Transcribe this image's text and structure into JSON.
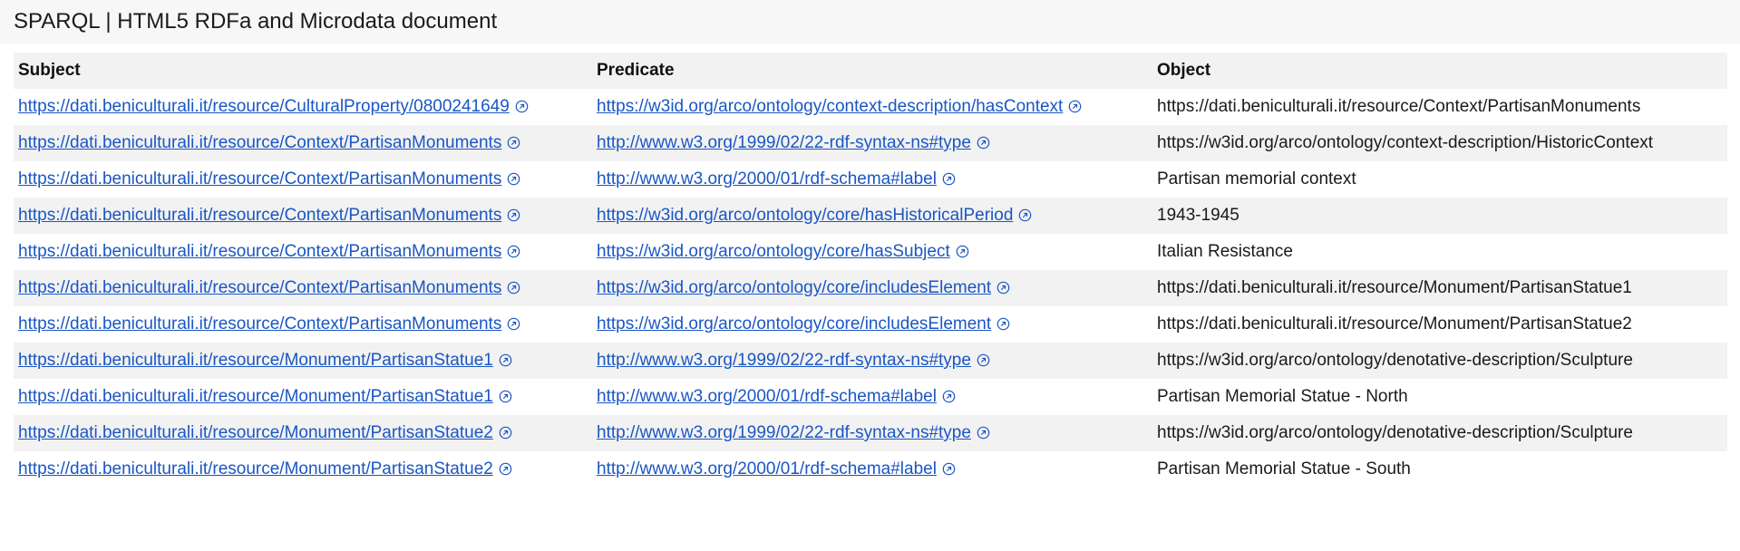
{
  "page": {
    "title": "SPARQL | HTML5 RDFa and Microdata document"
  },
  "table": {
    "headers": {
      "subject": "Subject",
      "predicate": "Predicate",
      "object": "Object"
    },
    "rows": [
      {
        "subject": "https://dati.beniculturali.it/resource/CulturalProperty/0800241649",
        "predicate": "https://w3id.org/arco/ontology/context-description/hasContext",
        "object": "https://dati.beniculturali.it/resource/Context/PartisanMonuments"
      },
      {
        "subject": "https://dati.beniculturali.it/resource/Context/PartisanMonuments",
        "predicate": "http://www.w3.org/1999/02/22-rdf-syntax-ns#type",
        "object": "https://w3id.org/arco/ontology/context-description/HistoricContext"
      },
      {
        "subject": "https://dati.beniculturali.it/resource/Context/PartisanMonuments",
        "predicate": "http://www.w3.org/2000/01/rdf-schema#label",
        "object": "Partisan memorial context"
      },
      {
        "subject": "https://dati.beniculturali.it/resource/Context/PartisanMonuments",
        "predicate": "https://w3id.org/arco/ontology/core/hasHistoricalPeriod",
        "object": "1943-1945"
      },
      {
        "subject": "https://dati.beniculturali.it/resource/Context/PartisanMonuments",
        "predicate": "https://w3id.org/arco/ontology/core/hasSubject",
        "object": "Italian Resistance"
      },
      {
        "subject": "https://dati.beniculturali.it/resource/Context/PartisanMonuments",
        "predicate": "https://w3id.org/arco/ontology/core/includesElement",
        "object": "https://dati.beniculturali.it/resource/Monument/PartisanStatue1"
      },
      {
        "subject": "https://dati.beniculturali.it/resource/Context/PartisanMonuments",
        "predicate": "https://w3id.org/arco/ontology/core/includesElement",
        "object": "https://dati.beniculturali.it/resource/Monument/PartisanStatue2"
      },
      {
        "subject": "https://dati.beniculturali.it/resource/Monument/PartisanStatue1",
        "predicate": "http://www.w3.org/1999/02/22-rdf-syntax-ns#type",
        "object": "https://w3id.org/arco/ontology/denotative-description/Sculpture"
      },
      {
        "subject": "https://dati.beniculturali.it/resource/Monument/PartisanStatue1",
        "predicate": "http://www.w3.org/2000/01/rdf-schema#label",
        "object": "Partisan Memorial Statue - North"
      },
      {
        "subject": "https://dati.beniculturali.it/resource/Monument/PartisanStatue2",
        "predicate": "http://www.w3.org/1999/02/22-rdf-syntax-ns#type",
        "object": "https://w3id.org/arco/ontology/denotative-description/Sculpture"
      },
      {
        "subject": "https://dati.beniculturali.it/resource/Monument/PartisanStatue2",
        "predicate": "http://www.w3.org/2000/01/rdf-schema#label",
        "object": "Partisan Memorial Statue - South"
      }
    ]
  },
  "icons": {
    "external": "external-link-icon"
  },
  "colors": {
    "link": "#1a56c4",
    "header_bg": "#f7f7f7",
    "row_alt_bg": "#f2f2f2"
  }
}
